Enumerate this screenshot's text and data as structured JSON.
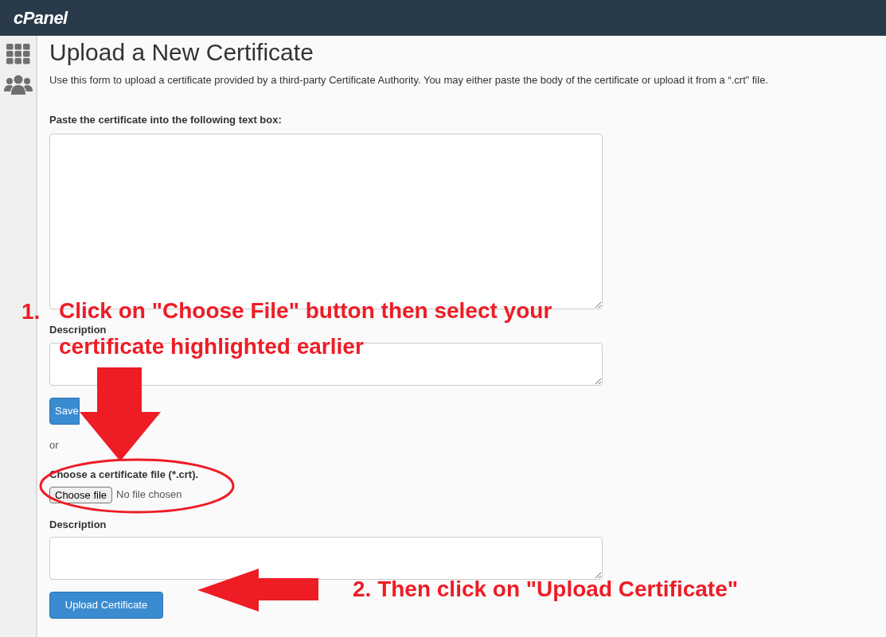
{
  "header": {
    "logo": "cPanel"
  },
  "page": {
    "title": "Upload a New Certificate",
    "intro": "Use this form to upload a certificate provided by a third-party Certificate Authority. You may either paste the body of the certificate or upload it from a “.crt” file.",
    "paste_label": "Paste the certificate into the following text box:",
    "description_label": "Description",
    "save_button": "Save",
    "or": "or",
    "file_label": "Choose a certificate file (*.crt).",
    "file_button": "Choose file",
    "file_status": "No file chosen",
    "description_label_2": "Description",
    "upload_button": "Upload Certificate"
  },
  "annotations": [
    {
      "number": "1.",
      "lines": [
        "Click on \"Choose File\" button then select your",
        "certificate highlighted earlier"
      ]
    },
    {
      "lines": [
        "2. Then click on \"Upload Certificate\""
      ]
    }
  ]
}
